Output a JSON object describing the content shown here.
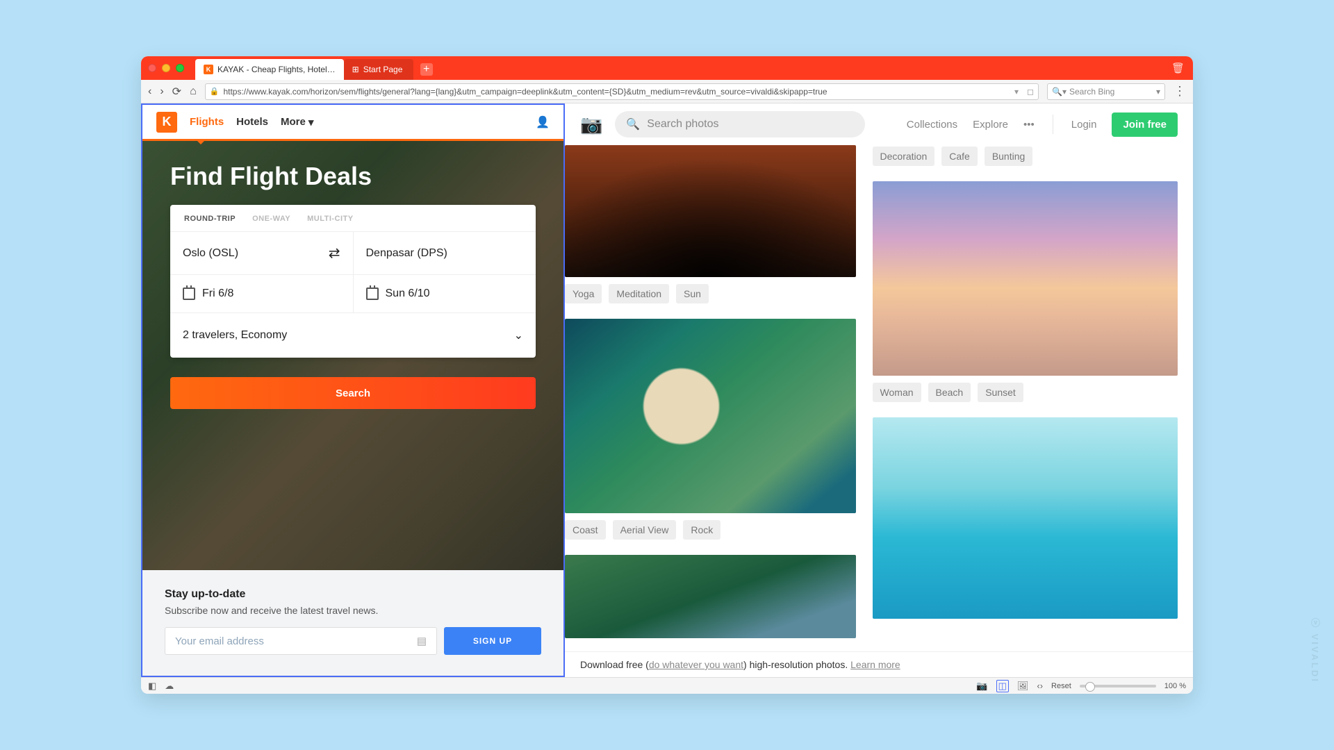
{
  "browser": {
    "tabs": [
      {
        "title": "KAYAK - Cheap Flights, Hotel…",
        "favicon": "K"
      },
      {
        "title": "Start Page"
      }
    ],
    "url": "https://www.kayak.com/horizon/sem/flights/general?lang={lang}&utm_campaign=deeplink&utm_content={SD}&utm_medium=rev&utm_source=vivaldi&skipapp=true",
    "search_placeholder": "Search Bing",
    "status": {
      "reset": "Reset",
      "zoom": "100 %"
    }
  },
  "kayak": {
    "nav": {
      "flights": "Flights",
      "hotels": "Hotels",
      "more": "More"
    },
    "hero_title": "Find Flight Deals",
    "trip_tabs": {
      "round": "ROUND-TRIP",
      "one": "ONE-WAY",
      "multi": "MULTI-CITY"
    },
    "from": "Oslo (OSL)",
    "to": "Denpasar (DPS)",
    "depart": "Fri 6/8",
    "return": "Sun 6/10",
    "travelers": "2 travelers, Economy",
    "search_btn": "Search",
    "footer": {
      "title": "Stay up-to-date",
      "sub": "Subscribe now and receive the latest travel news.",
      "email_placeholder": "Your email address",
      "signup": "SIGN UP"
    }
  },
  "unsplash": {
    "search_placeholder": "Search photos",
    "nav": {
      "collections": "Collections",
      "explore": "Explore",
      "login": "Login",
      "join": "Join free"
    },
    "top_tags": [
      "Decoration",
      "Cafe",
      "Bunting"
    ],
    "img1_tags": [
      "Yoga",
      "Meditation",
      "Sun"
    ],
    "img2_tags": [
      "Coast",
      "Aerial View",
      "Rock"
    ],
    "img4_tags": [
      "Woman",
      "Beach",
      "Sunset"
    ],
    "dl_pre": "Download free (",
    "dl_link1": "do whatever you want",
    "dl_mid": ") high-resolution photos. ",
    "dl_link2": "Learn more"
  }
}
